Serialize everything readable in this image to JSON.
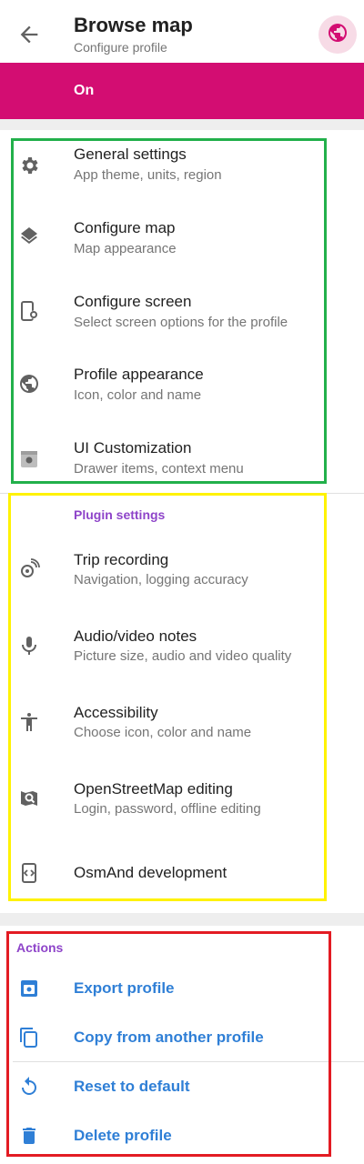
{
  "header": {
    "title": "Browse map",
    "subtitle": "Configure profile",
    "back_icon": "arrow-back-icon",
    "profile_icon": "globe-icon"
  },
  "profile_status": {
    "label": "On"
  },
  "settings": [
    {
      "label": "General settings",
      "description": "App theme, units, region",
      "icon": "gear-icon"
    },
    {
      "label": "Configure map",
      "description": "Map appearance",
      "icon": "layers-icon"
    },
    {
      "label": "Configure screen",
      "description": "Select screen options for the profile",
      "icon": "phone-settings-icon"
    },
    {
      "label": "Profile appearance",
      "description": "Icon, color and name",
      "icon": "globe-icon"
    },
    {
      "label": "UI Customization",
      "description": "Drawer items, context menu",
      "icon": "ui-customization-icon"
    }
  ],
  "plugins": {
    "title": "Plugin settings",
    "items": [
      {
        "label": "Trip recording",
        "description": "Navigation, logging accuracy",
        "icon": "trip-recording-icon"
      },
      {
        "label": "Audio/video notes",
        "description": "Picture size, audio and video quality",
        "icon": "microphone-icon"
      },
      {
        "label": "Accessibility",
        "description": "Choose icon, color and name",
        "icon": "accessibility-icon"
      },
      {
        "label": "OpenStreetMap editing",
        "description": "Login, password, offline editing",
        "icon": "osm-edit-icon"
      },
      {
        "label": "OsmAnd development",
        "icon": "development-icon"
      }
    ]
  },
  "actions": {
    "title": "Actions",
    "items": [
      {
        "label": "Export profile",
        "icon": "export-icon"
      },
      {
        "label": "Copy from another profile",
        "icon": "copy-icon"
      },
      {
        "label": "Reset to default",
        "icon": "reset-icon"
      },
      {
        "label": "Delete profile",
        "icon": "trash-icon"
      }
    ]
  },
  "colors": {
    "brand": "#d30d72",
    "section_title": "#8e44c9",
    "action_text": "#2f7fd6",
    "box_green": "#22b04b",
    "box_yellow": "#fff200",
    "box_red": "#e31b23"
  }
}
